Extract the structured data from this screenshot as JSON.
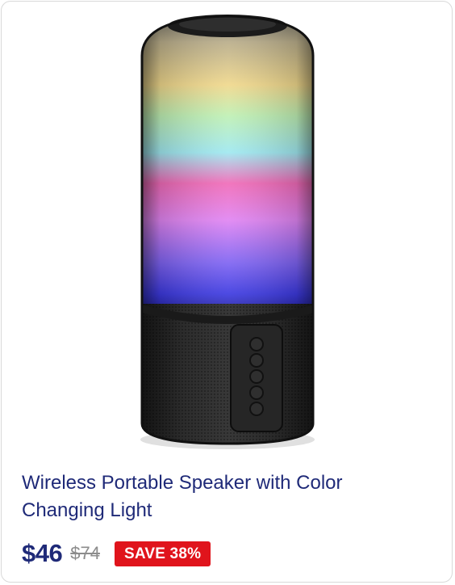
{
  "product": {
    "image_icon": "color-changing-speaker-image",
    "title": "Wireless Portable Speaker with Color Changing Light",
    "price": "$46",
    "original_price": "$74",
    "badge": "SAVE 38%"
  },
  "colors": {
    "title": "#1f2a78",
    "price": "#1f2a78",
    "original_price": "#8c8c8c",
    "badge_bg": "#e0141c",
    "badge_text": "#ffffff"
  }
}
